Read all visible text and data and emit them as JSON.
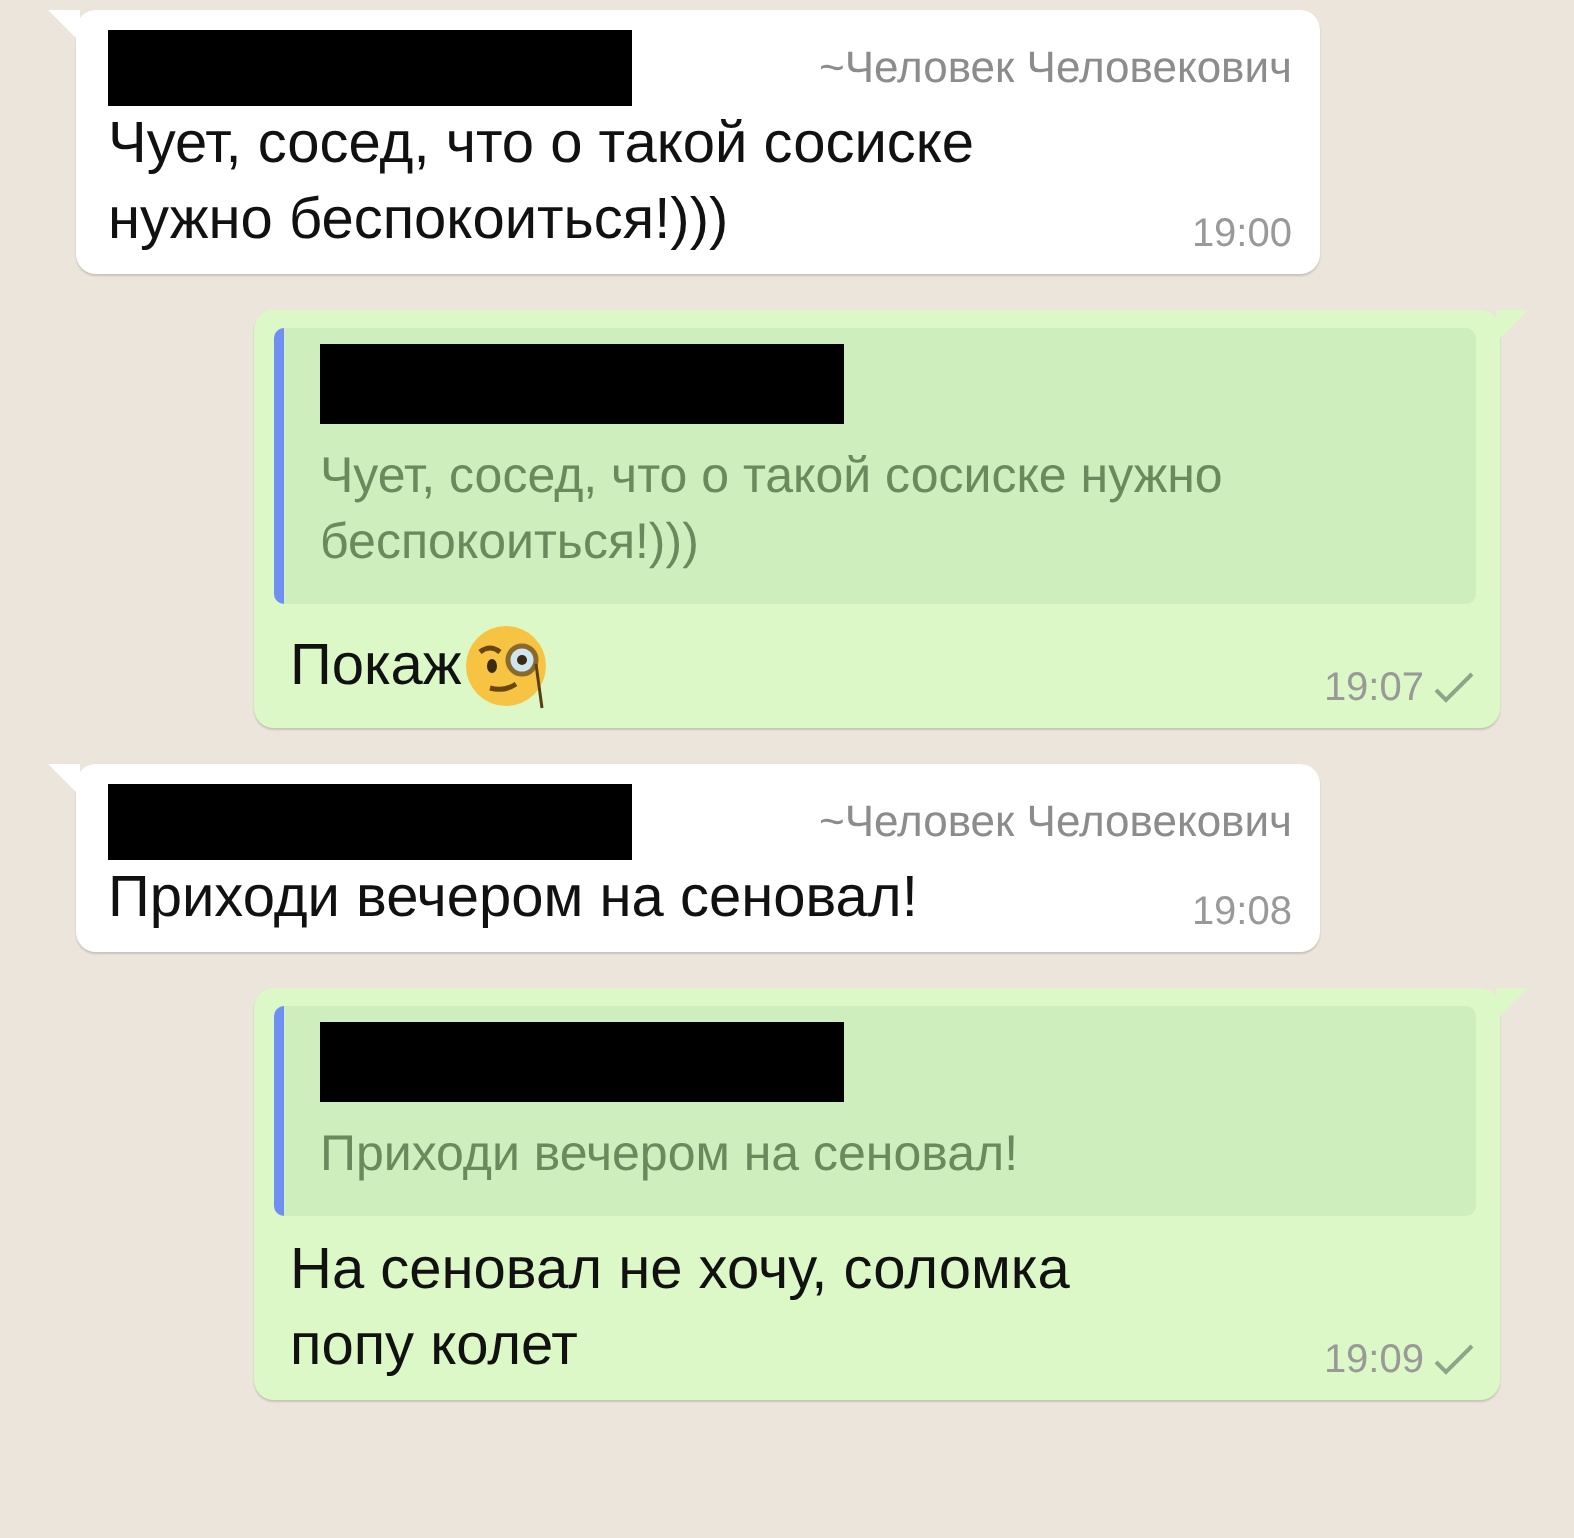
{
  "messages": [
    {
      "kind": "incoming",
      "sender": {
        "redacted": true,
        "name": "~Человек Человекович"
      },
      "text": "Чует, сосед, что о такой сосиске нужно беспокоиться!)))",
      "time": "19:00"
    },
    {
      "kind": "outgoing",
      "quote": {
        "redacted": true,
        "text": "Чует, сосед, что о такой сосиске нужно беспокоиться!)))"
      },
      "text": "Покаж",
      "emoji": true,
      "time": "19:07",
      "sent": true
    },
    {
      "kind": "incoming",
      "sender": {
        "redacted": true,
        "name": "~Человек Человекович"
      },
      "text": "Приходи вечером на сеновал!",
      "time": "19:08"
    },
    {
      "kind": "outgoing",
      "quote": {
        "redacted": true,
        "text": "Приходи вечером на сеновал!"
      },
      "text": "На сеновал не хочу, соломка попу колет",
      "time": "19:09",
      "sent": true
    }
  ]
}
